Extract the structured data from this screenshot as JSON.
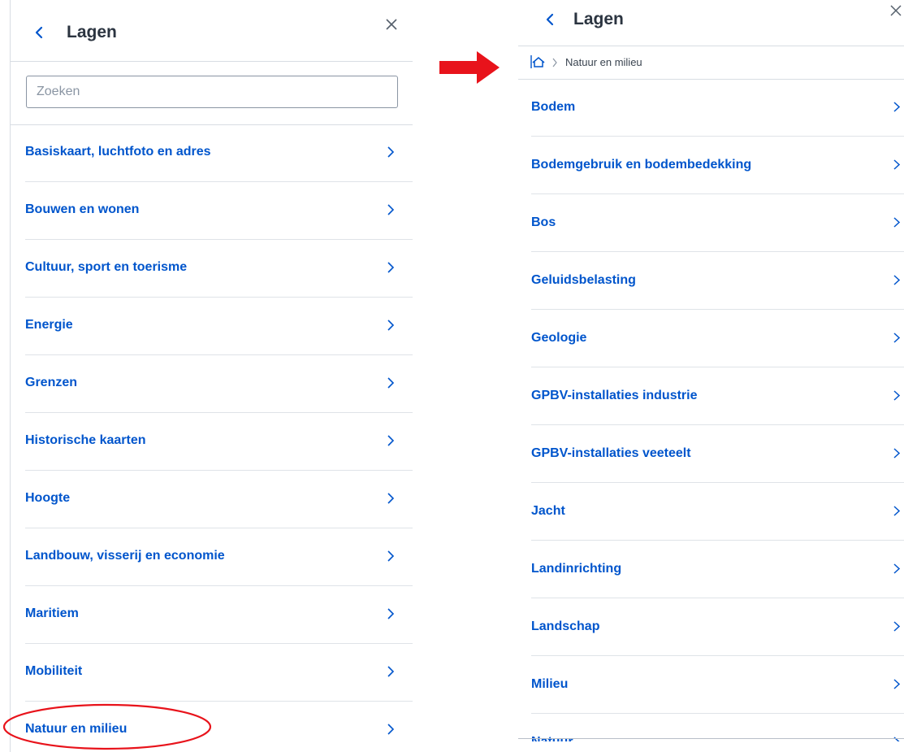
{
  "left_panel": {
    "title": "Lagen",
    "search_placeholder": "Zoeken",
    "items": [
      {
        "label": "Basiskaart, luchtfoto en adres"
      },
      {
        "label": "Bouwen en wonen"
      },
      {
        "label": "Cultuur, sport en toerisme"
      },
      {
        "label": "Energie"
      },
      {
        "label": "Grenzen"
      },
      {
        "label": "Historische kaarten"
      },
      {
        "label": "Hoogte"
      },
      {
        "label": "Landbouw, visserij en economie"
      },
      {
        "label": "Maritiem"
      },
      {
        "label": "Mobiliteit"
      },
      {
        "label": "Natuur en milieu"
      }
    ],
    "highlight_color": "#e8131b"
  },
  "arrow": {
    "color": "#e8131b"
  },
  "right_panel": {
    "title": "Lagen",
    "breadcrumb": {
      "home_icon": "home-icon",
      "current": "Natuur en milieu"
    },
    "items": [
      {
        "label": "Bodem"
      },
      {
        "label": "Bodemgebruik en bodembedekking"
      },
      {
        "label": "Bos"
      },
      {
        "label": "Geluidsbelasting"
      },
      {
        "label": "Geologie"
      },
      {
        "label": "GPBV-installaties industrie"
      },
      {
        "label": "GPBV-installaties veeteelt"
      },
      {
        "label": "Jacht"
      },
      {
        "label": "Landinrichting"
      },
      {
        "label": "Landschap"
      },
      {
        "label": "Milieu"
      },
      {
        "label": "Natuur"
      }
    ]
  },
  "colors": {
    "link_blue": "#0055cc",
    "title_text": "#2b3440",
    "divider": "#dfe3e8"
  }
}
